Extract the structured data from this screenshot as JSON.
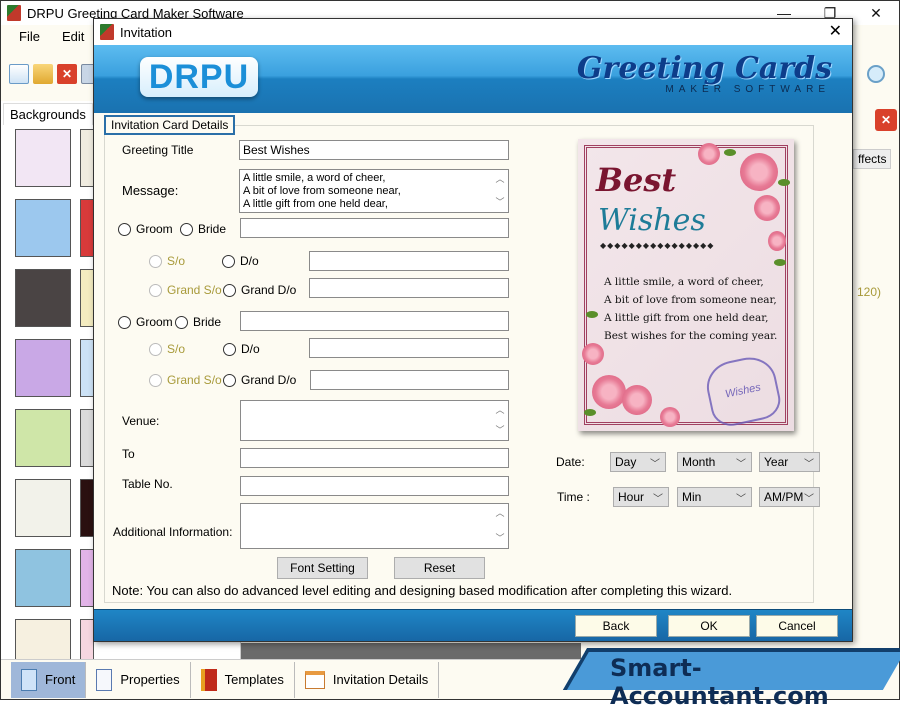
{
  "app": {
    "title": "DRPU Greeting Card Maker Software",
    "window_controls": {
      "minimize": "—",
      "maximize": "❐",
      "close": "✕"
    },
    "menu": [
      "File",
      "Edit"
    ]
  },
  "toolbar": {
    "icons": [
      "new-icon",
      "open-icon",
      "close-file-icon",
      "save-icon"
    ]
  },
  "left_panel": {
    "tab_label": "Backgrounds",
    "thumbnails": [
      {
        "name": "baby-pattern",
        "color": "#f2e6f4"
      },
      {
        "name": "clouds",
        "color": "#9cc8ee"
      },
      {
        "name": "dark-flowers",
        "color": "#4a4444"
      },
      {
        "name": "colorful-flowers",
        "color": "#c9a8e6"
      },
      {
        "name": "green-trees",
        "color": "#cfe6a8"
      },
      {
        "name": "green-leaves",
        "color": "#f2f2ea"
      },
      {
        "name": "santa-pattern",
        "color": "#8fc3e0"
      },
      {
        "name": "stars",
        "color": "#f6f0e0"
      }
    ],
    "thumbnails_col2_colors": [
      "#f0ece0",
      "#d83a3a",
      "#f4ecc0",
      "#cce2f6",
      "#dadada",
      "#2a1010",
      "#e2b4e8",
      "#f6d6e0"
    ]
  },
  "right_panel": {
    "tab_fragment": "ffects",
    "value_fragment": "120)"
  },
  "bottom_tabs": [
    {
      "label": "Front",
      "icon": "front-page-icon",
      "active": true
    },
    {
      "label": "Properties",
      "icon": "properties-icon",
      "active": false
    },
    {
      "label": "Templates",
      "icon": "templates-icon",
      "active": false
    },
    {
      "label": "Invitation Details",
      "icon": "invitation-details-icon",
      "active": false
    }
  ],
  "dialog": {
    "title": "Invitation",
    "close": "✕",
    "banner": {
      "logo_text": "DRPU",
      "brand_main": "Greeting Cards",
      "brand_sub": "MAKER SOFTWARE"
    },
    "group_label": "Invitation Card Details",
    "fields": {
      "greeting_title_label": "Greeting Title",
      "greeting_title_value": "Best Wishes",
      "message_label": "Message:",
      "message_lines": [
        "A little smile, a word of cheer,",
        "A bit of love from someone near,",
        "A little gift from one held dear,"
      ],
      "groom_label": "Groom",
      "bride_label": "Bride",
      "so_label": "S/o",
      "do_label": "D/o",
      "grand_so_label": "Grand S/o",
      "grand_do_label": "Grand D/o",
      "venue_label": "Venue:",
      "to_label": "To",
      "table_no_label": "Table No.",
      "additional_info_label": "Additional Information:"
    },
    "buttons": {
      "font_setting": "Font Setting",
      "reset": "Reset",
      "back": "Back",
      "ok": "OK",
      "cancel": "Cancel"
    },
    "note": "Note: You can also do advanced level editing and designing based modification after completing this wizard.",
    "date": {
      "label": "Date:",
      "day": "Day",
      "month": "Month",
      "year": "Year"
    },
    "time": {
      "label": "Time :",
      "hour": "Hour",
      "min": "Min",
      "ampm": "AM/PM"
    },
    "preview": {
      "title_line1": "Best",
      "title_line2": "Wishes",
      "dots": "◆◆◆◆◆◆◆◆◆◆◆◆◆◆◆◆",
      "verse": [
        "A little smile, a word of cheer,",
        "A bit of love from someone near,",
        "A little gift from one held dear,",
        "Best wishes for the coming year."
      ],
      "stamp_text": "Wishes"
    }
  },
  "watermark": "Smart-Accountant.com",
  "colors": {
    "banner_blue": "#1c7fc0",
    "dialog_bg": "#fdfbf2",
    "disabled_radio_text": "#a89a3a",
    "card_title_red": "#7a1530",
    "card_title_teal": "#1e7c98"
  }
}
